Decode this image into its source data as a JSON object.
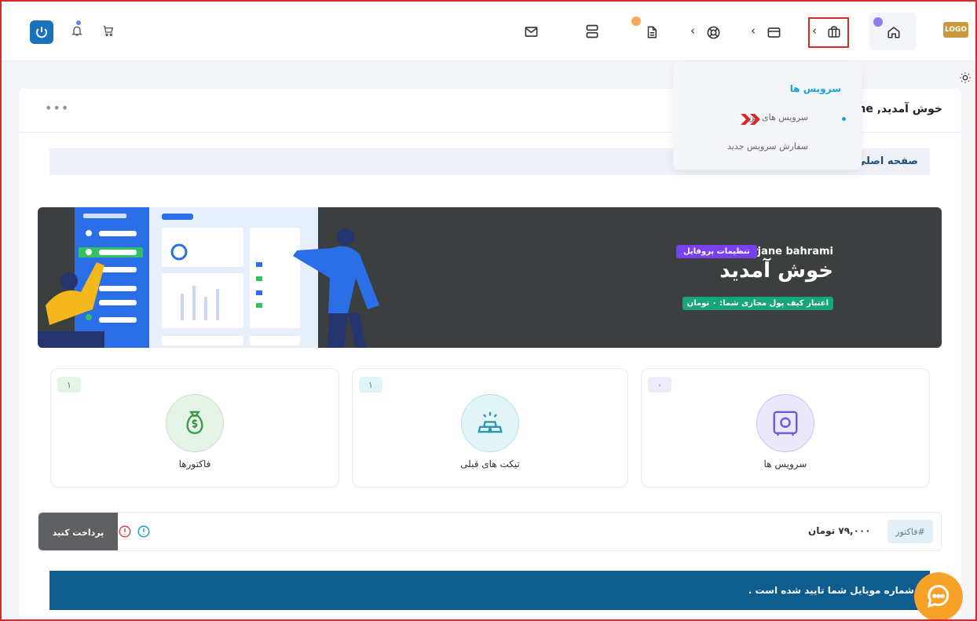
{
  "brand": {
    "logo_text": "LOGO"
  },
  "nav": {
    "home_icon": "home-icon",
    "services_icon": "briefcase-icon",
    "billing_icon": "credit-card-icon",
    "support_icon": "lifebuoy-icon",
    "invoices_icon": "document-icon",
    "servers_icon": "server-icon",
    "mail_icon": "mail-icon",
    "cart_icon": "cart-icon",
    "notify_icon": "bell-icon",
    "power_icon": "power-icon",
    "chevron": "‹"
  },
  "dropdown": {
    "title": "سرویس ها",
    "items": [
      "سرویس های من",
      "سفارش سرویس جدید"
    ]
  },
  "page": {
    "welcome": "خوش آمدید, jane",
    "more": "•••",
    "breadcrumb": "صفحه اصلی پ"
  },
  "banner": {
    "name": "marjane bahrami",
    "profile_button": "تنظیمات پروفایل",
    "greeting": "خوش آمدید",
    "credit": "اعتبار کیف پول مجازی شما: ۰ تومان"
  },
  "stats": [
    {
      "label": "سرویس ها",
      "count": "۰",
      "icon": "safe-icon"
    },
    {
      "label": "تیکت های قبلی",
      "count": "۱",
      "icon": "gold-bars-icon"
    },
    {
      "label": "فاکتورها",
      "count": "۱",
      "icon": "money-bag-icon"
    }
  ],
  "invoice": {
    "tag": "فاکتور#",
    "amount": "۷۹,۰۰۰ تومان",
    "pay_button": "پرداخت کنید"
  },
  "alert": {
    "text": "شماره موبایل شما تایید شده است ."
  },
  "colors": {
    "accent": "#1aa1d6",
    "banner_bg": "#3c3f40",
    "profile_btn": "#7a3ff0",
    "credit_badge": "#17a57b",
    "alert_bg": "#0f5c8f",
    "chat": "#f7a126"
  }
}
